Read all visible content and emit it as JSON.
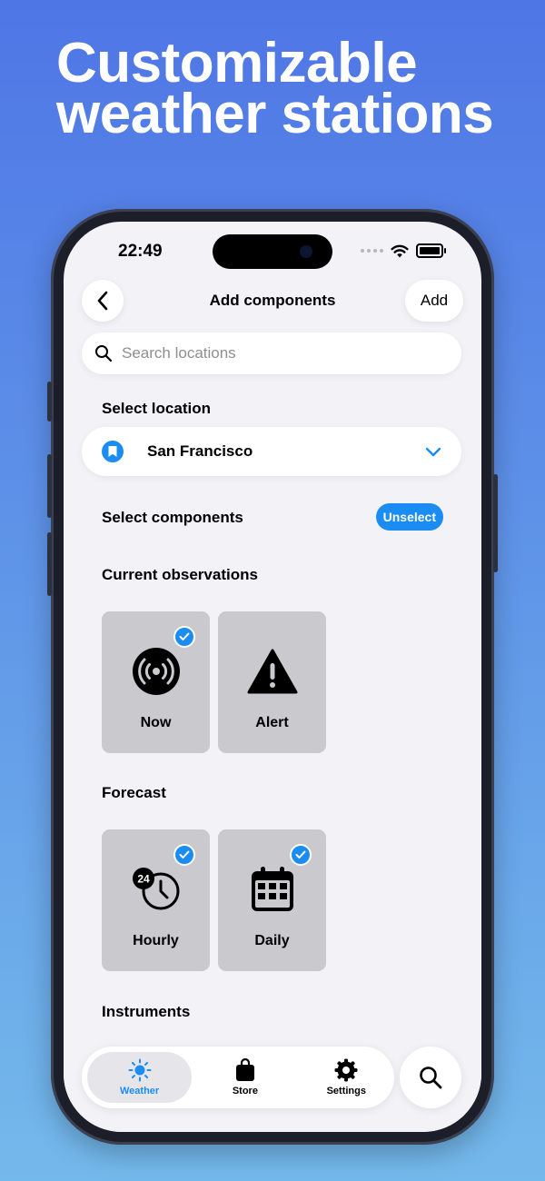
{
  "headline": {
    "line1": "Customizable",
    "line2": "weather stations"
  },
  "status_bar": {
    "time": "22:49"
  },
  "nav": {
    "title": "Add components",
    "add_label": "Add"
  },
  "search": {
    "placeholder": "Search locations"
  },
  "location_section": {
    "label": "Select location",
    "selected": "San Francisco"
  },
  "components_section": {
    "label": "Select components",
    "unselect_label": "Unselect"
  },
  "groups": [
    {
      "title": "Current observations",
      "tiles": [
        {
          "label": "Now",
          "icon": "broadcast-icon",
          "checked": true
        },
        {
          "label": "Alert",
          "icon": "warning-icon",
          "checked": false
        }
      ]
    },
    {
      "title": "Forecast",
      "tiles": [
        {
          "label": "Hourly",
          "icon": "clock-24-icon",
          "checked": true
        },
        {
          "label": "Daily",
          "icon": "calendar-icon",
          "checked": true
        }
      ]
    },
    {
      "title": "Instruments",
      "tiles": []
    }
  ],
  "tabbar": {
    "tabs": [
      {
        "label": "Weather",
        "icon": "sun-icon",
        "active": true
      },
      {
        "label": "Store",
        "icon": "bag-icon",
        "active": false
      },
      {
        "label": "Settings",
        "icon": "gear-icon",
        "active": false
      }
    ]
  },
  "colors": {
    "accent": "#1a8cf2",
    "background": "#f2f2f7",
    "tile": "#c9c9ce"
  }
}
